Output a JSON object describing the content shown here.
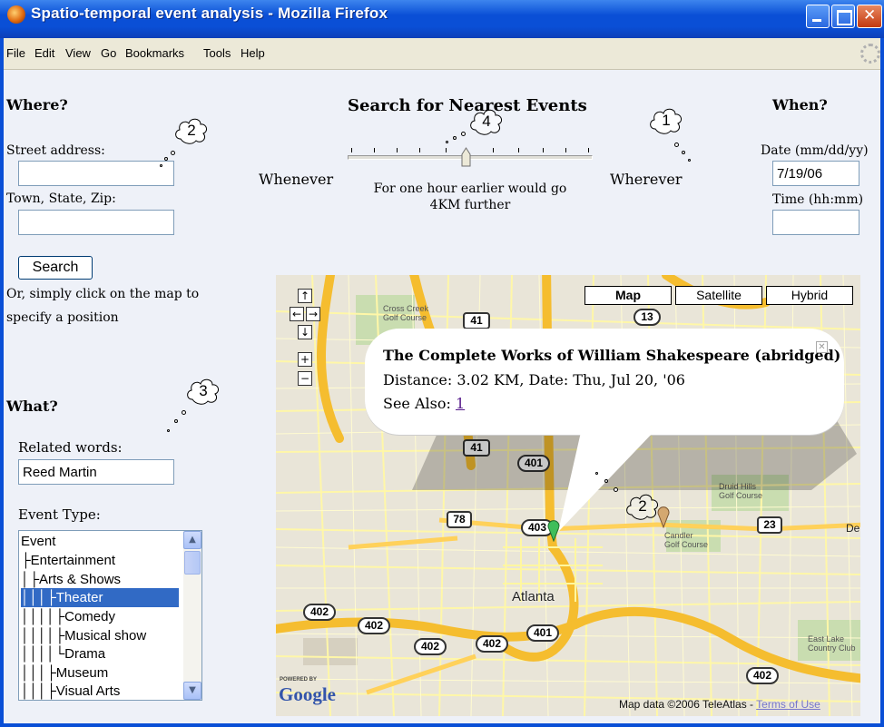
{
  "window": {
    "title": "Spatio-temporal event analysis - Mozilla Firefox"
  },
  "menu": [
    "File",
    "Edit",
    "View",
    "Go",
    "Bookmarks",
    "Tools",
    "Help"
  ],
  "where": {
    "heading": "Where?",
    "street_label": "Street address:",
    "street_value": "",
    "town_label": "Town, State, Zip:",
    "town_value": "",
    "search_button": "Search",
    "hint_line1": "Or, simply click on the map to",
    "hint_line2": "specify a position"
  },
  "search": {
    "title": "Search for Nearest Events",
    "left_label": "Whenever",
    "right_label": "Wherever",
    "slider_caption_line1": "For one hour earlier would go",
    "slider_caption_line2": "4KM further",
    "slider_position": 0.48
  },
  "when": {
    "heading": "When?",
    "date_label": "Date (mm/dd/yy)",
    "date_value": "7/19/06",
    "time_label": "Time (hh:mm)",
    "time_value": ""
  },
  "what": {
    "heading": "What?",
    "related_label": "Related words:",
    "related_value": "Reed Martin",
    "event_type_label": "Event Type:",
    "event_types": [
      {
        "text": "Event",
        "selected": false
      },
      {
        "text": "├Entertainment",
        "selected": false
      },
      {
        "text": "│├Arts & Shows",
        "selected": false
      },
      {
        "text": "│││├Theater",
        "selected": true
      },
      {
        "text": "││││├Comedy",
        "selected": false
      },
      {
        "text": "││││├Musical show",
        "selected": false
      },
      {
        "text": "││││└Drama",
        "selected": false
      },
      {
        "text": "│││├Museum",
        "selected": false
      },
      {
        "text": "│││├Visual Arts",
        "selected": false
      }
    ]
  },
  "callouts": [
    "2",
    "4",
    "1",
    "3",
    "2"
  ],
  "map": {
    "type_buttons": [
      "Map",
      "Satellite",
      "Hybrid"
    ],
    "nav_icons": [
      "arrow-up-icon",
      "arrow-left-icon",
      "arrow-right-icon",
      "arrow-down-icon",
      "zoom-in-icon",
      "zoom-out-icon"
    ],
    "popup": {
      "title": "The Complete Works of William Shakespeare (abridged)",
      "detail": "Distance: 3.02 KM, Date: Thu, Jul 20, '06",
      "see_also_label": "See Also:",
      "see_also_link": "1"
    },
    "place_labels": {
      "cross_creek": "Cross Creek\nGolf Course",
      "druid_hills": "Druid Hills\nGolf Course",
      "candler": "Candler\nGolf Course",
      "east_lake": "East Lake\nCountry Club",
      "atlanta": "Atlanta",
      "de": "De"
    },
    "shields": [
      "41",
      "13",
      "41",
      "401",
      "78",
      "403",
      "23",
      "402",
      "402",
      "402",
      "402",
      "401",
      "402"
    ],
    "powered_by": "POWERED BY",
    "logo": "Google",
    "copyright": "Map data ©2006 TeleAtlas - ",
    "terms": "Terms of Use"
  },
  "colors": {
    "titlebar": "#0a4fd6",
    "content_bg": "#eef1f8",
    "selection": "#316ac5",
    "road_major": "#f5bd2f",
    "road_minor": "#fff78a"
  }
}
